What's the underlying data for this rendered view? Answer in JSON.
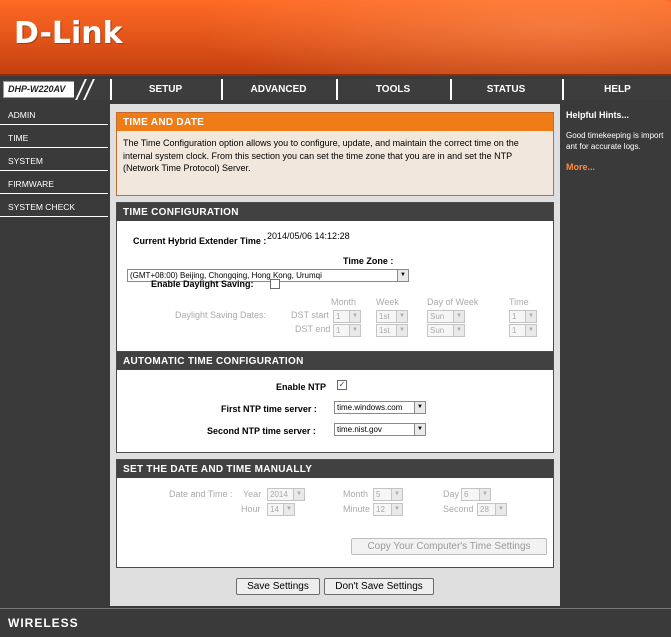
{
  "header": {
    "logo": "D-Link"
  },
  "model": "DHP-W220AV",
  "nav": [
    "SETUP",
    "ADVANCED",
    "TOOLS",
    "STATUS",
    "HELP"
  ],
  "sidebar": [
    "ADMIN",
    "TIME",
    "SYSTEM",
    "FIRMWARE",
    "SYSTEM CHECK"
  ],
  "intro": {
    "title": "TIME AND DATE",
    "text": "The Time Configuration option allows you to configure, update, and maintain the correct time on the internal system clock. From this section you can set the time zone that you are in and set the NTP (Network Time Protocol) Server."
  },
  "time_config": {
    "title": "TIME CONFIGURATION",
    "current_time_label": "Current Hybrid Extender Time :",
    "current_time_value": "2014/05/06 14:12:28",
    "timezone_label": "Time Zone :",
    "timezone_value": "(GMT+08:00) Beijing, Chongqing, Hong Kong, Urumqi",
    "daylight_label": "Enable Daylight Saving:",
    "dst_dates_label": "Daylight Saving Dates:",
    "col_month": "Month",
    "col_week": "Week",
    "col_dow": "Day of Week",
    "col_time": "Time",
    "dst_start_label": "DST start",
    "dst_end_label": "DST end",
    "start": {
      "month": "1",
      "week": "1st",
      "dow": "Sun",
      "time": "1"
    },
    "end": {
      "month": "1",
      "week": "1st",
      "dow": "Sun",
      "time": "1"
    }
  },
  "auto_time": {
    "title": "AUTOMATIC TIME CONFIGURATION",
    "enable_ntp_label": "Enable NTP",
    "enable_ntp_checked": true,
    "first_label": "First NTP time server :",
    "first_value": "time.windows.com",
    "second_label": "Second NTP time server :",
    "second_value": "time.nist.gov"
  },
  "manual": {
    "title": "SET THE DATE AND TIME MANUALLY",
    "date_time_label": "Date and Time :",
    "year_label": "Year",
    "year_value": "2014",
    "month_label": "Month",
    "month_value": "5",
    "day_label": "Day",
    "day_value": "6",
    "hour_label": "Hour",
    "hour_value": "14",
    "minute_label": "Minute",
    "minute_value": "12",
    "second_label": "Second",
    "second_value": "28",
    "copy_button": "Copy Your Computer's Time Settings"
  },
  "buttons": {
    "save": "Save Settings",
    "dont_save": "Don't Save Settings"
  },
  "hints": {
    "title": "Helpful Hints...",
    "text": "Good timekeeping is important for accurate logs.",
    "more": "More..."
  },
  "footer": {
    "text": "WIRELESS"
  },
  "colors": {
    "accent": "#f07c18",
    "bar": "#414141",
    "panel": "#dfdfdf"
  }
}
